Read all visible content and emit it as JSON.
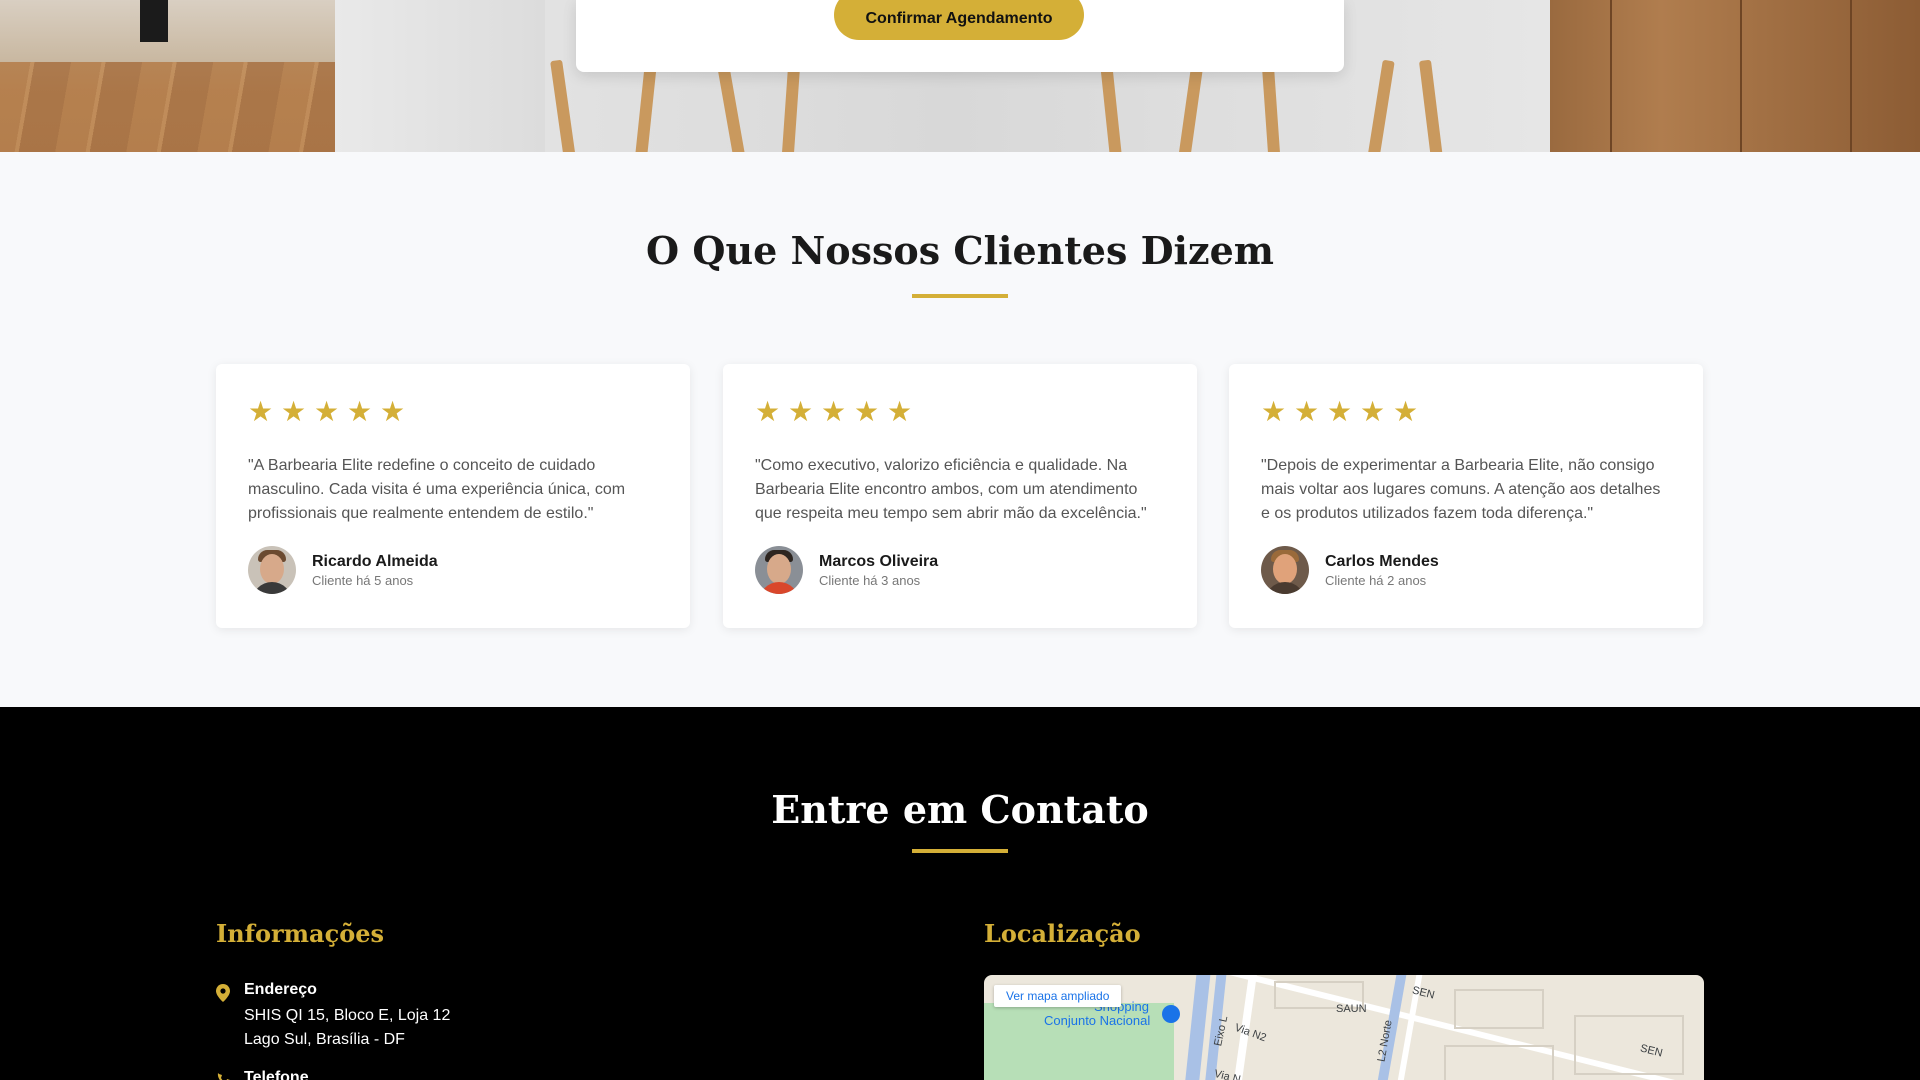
{
  "booking": {
    "confirm_label": "Confirmar Agendamento"
  },
  "testimonials": {
    "title": "O Que Nossos Clientes Dizem",
    "items": [
      {
        "rating": 5,
        "quote": "\"A Barbearia Elite redefine o conceito de cuidado masculino. Cada visita é uma experiência única, com profissionais que realmente entendem de estilo.\"",
        "name": "Ricardo Almeida",
        "since": "Cliente há 5 anos"
      },
      {
        "rating": 5,
        "quote": "\"Como executivo, valorizo eficiência e qualidade. Na Barbearia Elite encontro ambos, com um atendimento que respeita meu tempo sem abrir mão da excelência.\"",
        "name": "Marcos Oliveira",
        "since": "Cliente há 3 anos"
      },
      {
        "rating": 5,
        "quote": "\"Depois de experimentar a Barbearia Elite, não consigo mais voltar aos lugares comuns. A atenção aos detalhes e os produtos utilizados fazem toda diferença.\"",
        "name": "Carlos Mendes",
        "since": "Cliente há 2 anos"
      }
    ]
  },
  "contact": {
    "title": "Entre em Contato",
    "info_title": "Informações",
    "location_title": "Localização",
    "address_label": "Endereço",
    "address_line1": "SHIS QI 15, Bloco E, Loja 12",
    "address_line2": "Lago Sul, Brasília - DF",
    "phone_label": "Telefone",
    "map": {
      "link_label": "Ver mapa ampliado",
      "labels": [
        "Shopping",
        "Conjunto Nacional",
        "Eixo L",
        "Via N2",
        "L2 Norte",
        "SAUN",
        "SEN",
        "SEN",
        "Via N"
      ]
    }
  },
  "colors": {
    "accent": "#d4af37",
    "dark": "#000000",
    "light_bg": "#f8f9fb"
  }
}
